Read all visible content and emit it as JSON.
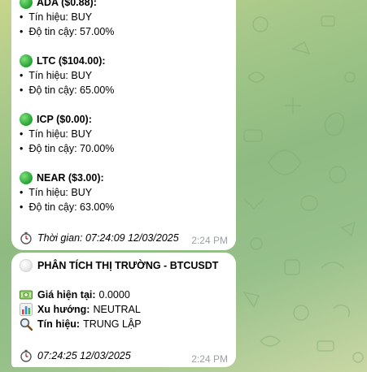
{
  "messages": [
    {
      "coins": [
        {
          "name": "ADA ($0.88):",
          "signal_label": "Tín hiệu:",
          "signal": "BUY",
          "conf_label": "Độ tin cậy:",
          "confidence": "57.00%"
        },
        {
          "name": "LTC ($104.00):",
          "signal_label": "Tín hiệu:",
          "signal": "BUY",
          "conf_label": "Độ tin cậy:",
          "confidence": "65.00%"
        },
        {
          "name": "ICP ($0.00):",
          "signal_label": "Tín hiệu:",
          "signal": "BUY",
          "conf_label": "Độ tin cậy:",
          "confidence": "70.00%"
        },
        {
          "name": "NEAR ($3.00):",
          "signal_label": "Tín hiệu:",
          "signal": "BUY",
          "conf_label": "Độ tin cậy:",
          "confidence": "63.00%"
        }
      ],
      "footer": "Thời gian: 07:24:09 12/03/2025",
      "time": "2:24 PM"
    },
    {
      "title": "PHÂN TÍCH THỊ TRƯỜNG - BTCUSDT",
      "price_label": "Giá hiện tại:",
      "price": "0.0000",
      "trend_label": "Xu hướng:",
      "trend": "NEUTRAL",
      "signal_label": "Tín hiệu:",
      "signal": "TRUNG LẬP",
      "footer": "07:24:25 12/03/2025",
      "time": "2:24 PM"
    }
  ],
  "icons": {
    "coin_status": "green-circle-icon",
    "title_status": "white-circle-icon",
    "price": "money-icon",
    "trend": "bar-chart-icon",
    "signal": "magnifier-icon",
    "time": "stopwatch-icon"
  },
  "colors": {
    "bubble": "#ffffff",
    "timestamp": "#9aa1a8",
    "status_green": "#2fa93b"
  }
}
